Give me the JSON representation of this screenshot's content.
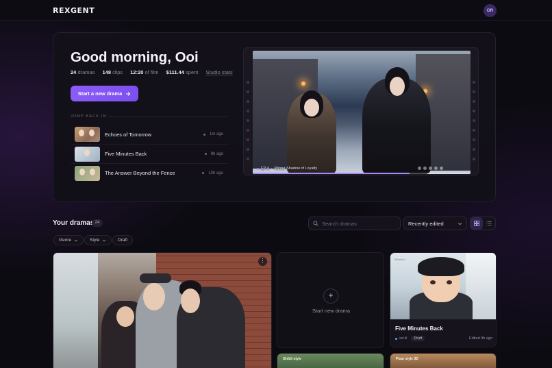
{
  "app": {
    "logo": "REXGENT",
    "avatar_initials": "OR"
  },
  "hero": {
    "greeting": "Good morning, Ooi",
    "stats": {
      "dramas_value": "24",
      "dramas_label": "dramas",
      "clips_value": "148",
      "clips_label": "clips",
      "film_value": "12:20",
      "film_label": "of film",
      "spent_value": "$111.44",
      "spent_label": "spent",
      "studio_link": "Studio stats"
    },
    "cta_label": "Start a new drama",
    "jump_back_label": "JUMP BACK IN",
    "recent": [
      {
        "title": "Echoes of Tomorrow",
        "time": "1m ago"
      },
      {
        "title": "Five Minutes Back",
        "time": "9h ago"
      },
      {
        "title": "The Answer Beyond the Fence",
        "time": "13h ago"
      }
    ],
    "player": {
      "episode": "EP 4",
      "episode_title": "Winter Shadow of Loyalty",
      "progress": 0.72
    }
  },
  "dramas": {
    "title": "Your dramas",
    "count": "24",
    "search_placeholder": "Search dramas",
    "sort_label": "Recently edited",
    "filters": [
      "Genre",
      "Style",
      "Draft"
    ],
    "new_card_label": "Start new drama",
    "cards": [
      {
        "style": "Anime",
        "title": "Five Minutes Back",
        "genre": "sci-fi",
        "status": "Draft",
        "edited": "Edited 9h ago"
      }
    ],
    "partial_cards": [
      {
        "style": "Ghibli style"
      },
      {
        "style": "Pixar style 3D"
      }
    ]
  },
  "colors": {
    "accent": "#8b5cf6",
    "background": "#0d0b12",
    "panel": "#131019"
  }
}
